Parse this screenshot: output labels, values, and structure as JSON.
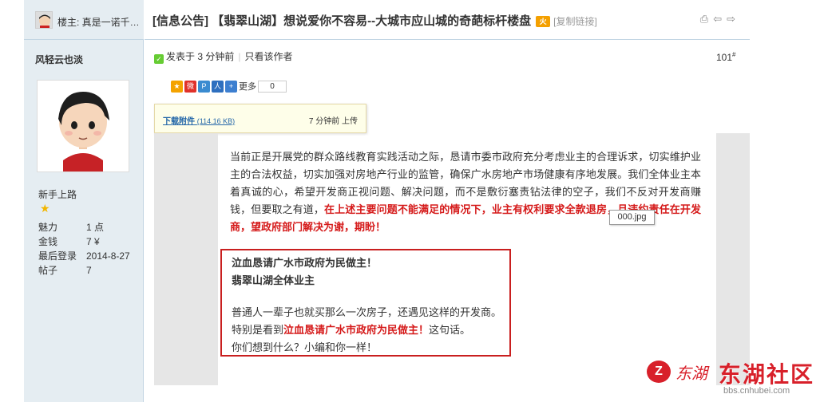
{
  "sidebar": {
    "op_label": "楼主: 真是一诺千…",
    "username": "风轻云也淡",
    "user_group": "新手上路",
    "star_icon": "star-icon",
    "stats": [
      {
        "key": "魅力",
        "value": "1 点"
      },
      {
        "key": "金钱",
        "value": "7 ¥"
      },
      {
        "key": "最后登录",
        "value": "2014-8-27"
      },
      {
        "key": "帖子",
        "value": "7"
      }
    ]
  },
  "thread": {
    "title_tag": "[信息公告]",
    "title": "【翡翠山湖】想说爱你不容易--大城市应山城的奇葩标杆楼盘",
    "hot_icon": "hot-icon",
    "copy_link": "[复制链接]"
  },
  "post": {
    "posted_at": "发表于 3 分钟前",
    "only_author": "只看该作者",
    "floor": "101",
    "floor_sup": "#",
    "share_more": "更多",
    "share_count": "0",
    "attachment": {
      "download_label": "下载附件",
      "size": "(114.16 KB)",
      "uploaded": "7 分钟前 上传"
    },
    "body_normal": "当前正是开展党的群众路线教育实践活动之际，恳请市委市政府充分考虑业主的合理诉求，切实维护业主的合法权益，切实加强对房地产行业的监管，确保广水房地产市场健康有序地发展。我们全体业主本着真诚的心，希望开发商正视问题、解决问题，而不是敷衍塞责钻法律的空子，我们不反对开发商赚钱，但要取之有道，",
    "body_red": "在上述主要问题不能满足的情况下，业主有权利要求全款退房，且违约责任在开发商，望政府部门解决为谢，期盼！",
    "image_tip": "000.jpg",
    "quote": {
      "line1": "泣血恳请广水市政府为民做主！",
      "line2": "翡翠山湖全体业主",
      "line3": "普通人一辈子也就买那么一次房子，还遇见这样的开发商。",
      "line4_pre": "特别是看到",
      "line4_red": "泣血恳请广水市政府为民做主！",
      "line4_post": "这句话。",
      "line5": "你们想到什么？小编和你一样！"
    }
  },
  "watermark": {
    "script": "东湖",
    "name": "东湖社区",
    "url": "bbs.cnhubei.com"
  },
  "colors": {
    "accent_red": "#d51a1a",
    "sidebar_bg": "#e5edf2",
    "link_blue": "#2366a8"
  }
}
